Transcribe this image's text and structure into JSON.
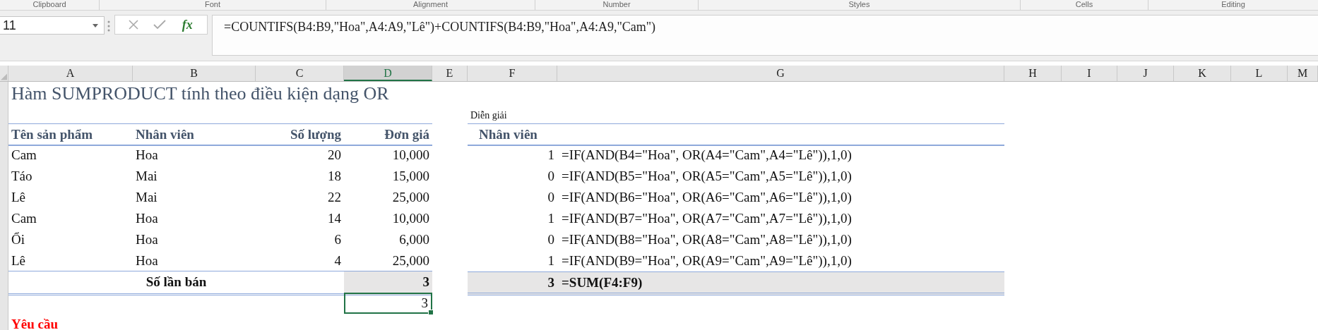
{
  "ribbon_groups": [
    "Clipboard",
    "Font",
    "Alignment",
    "Number",
    "Styles",
    "Cells",
    "Editing"
  ],
  "name_box": "11",
  "formula_bar": {
    "fx_label": "fx",
    "value": "=COUNTIFS(B4:B9,\"Hoa\",A4:A9,\"Lê\")+COUNTIFS(B4:B9,\"Hoa\",A4:A9,\"Cam\")"
  },
  "column_headers": [
    {
      "label": "A",
      "selected": false
    },
    {
      "label": "B",
      "selected": false
    },
    {
      "label": "C",
      "selected": false
    },
    {
      "label": "D",
      "selected": true
    },
    {
      "label": "E",
      "selected": false
    },
    {
      "label": "F",
      "selected": false
    },
    {
      "label": "G",
      "selected": false
    },
    {
      "label": "H",
      "selected": false
    },
    {
      "label": "I",
      "selected": false
    },
    {
      "label": "J",
      "selected": false
    },
    {
      "label": "K",
      "selected": false
    },
    {
      "label": "L",
      "selected": false
    },
    {
      "label": "M",
      "selected": false
    }
  ],
  "title": "Hàm SUMPRODUCT tính theo điều kiện dạng OR",
  "table": {
    "columns": [
      "Tên sản phẩm",
      "Nhân viên",
      "Số lượng",
      "Đơn giá"
    ],
    "rows": [
      [
        "Cam",
        "Hoa",
        "20",
        "10,000"
      ],
      [
        "Táo",
        "Mai",
        "18",
        "15,000"
      ],
      [
        "Lê",
        "Mai",
        "22",
        "25,000"
      ],
      [
        "Cam",
        "Hoa",
        "14",
        "10,000"
      ],
      [
        "Ổi",
        "Hoa",
        "6",
        "6,000"
      ],
      [
        "Lê",
        "Hoa",
        "4",
        "25,000"
      ]
    ],
    "total": {
      "label": "Số lần bán",
      "value": "3"
    },
    "selected_cell": {
      "value": "3"
    }
  },
  "explanation": {
    "caption": "Diễn giải",
    "header": "Nhân viên",
    "rows": [
      {
        "value": "1",
        "formula": "=IF(AND(B4=\"Hoa\", OR(A4=\"Cam\",A4=\"Lê\")),1,0)"
      },
      {
        "value": "0",
        "formula": "=IF(AND(B5=\"Hoa\", OR(A5=\"Cam\",A5=\"Lê\")),1,0)"
      },
      {
        "value": "0",
        "formula": "=IF(AND(B6=\"Hoa\", OR(A6=\"Cam\",A6=\"Lê\")),1,0)"
      },
      {
        "value": "1",
        "formula": "=IF(AND(B7=\"Hoa\", OR(A7=\"Cam\",A7=\"Lê\")),1,0)"
      },
      {
        "value": "0",
        "formula": "=IF(AND(B8=\"Hoa\", OR(A8=\"Cam\",A8=\"Lê\")),1,0)"
      },
      {
        "value": "1",
        "formula": "=IF(AND(B9=\"Hoa\", OR(A9=\"Cam\",A9=\"Lê\")),1,0)"
      }
    ],
    "total": {
      "value": "3",
      "formula": "=SUM(F4:F9)"
    }
  },
  "requirement": "Yêu cầu"
}
